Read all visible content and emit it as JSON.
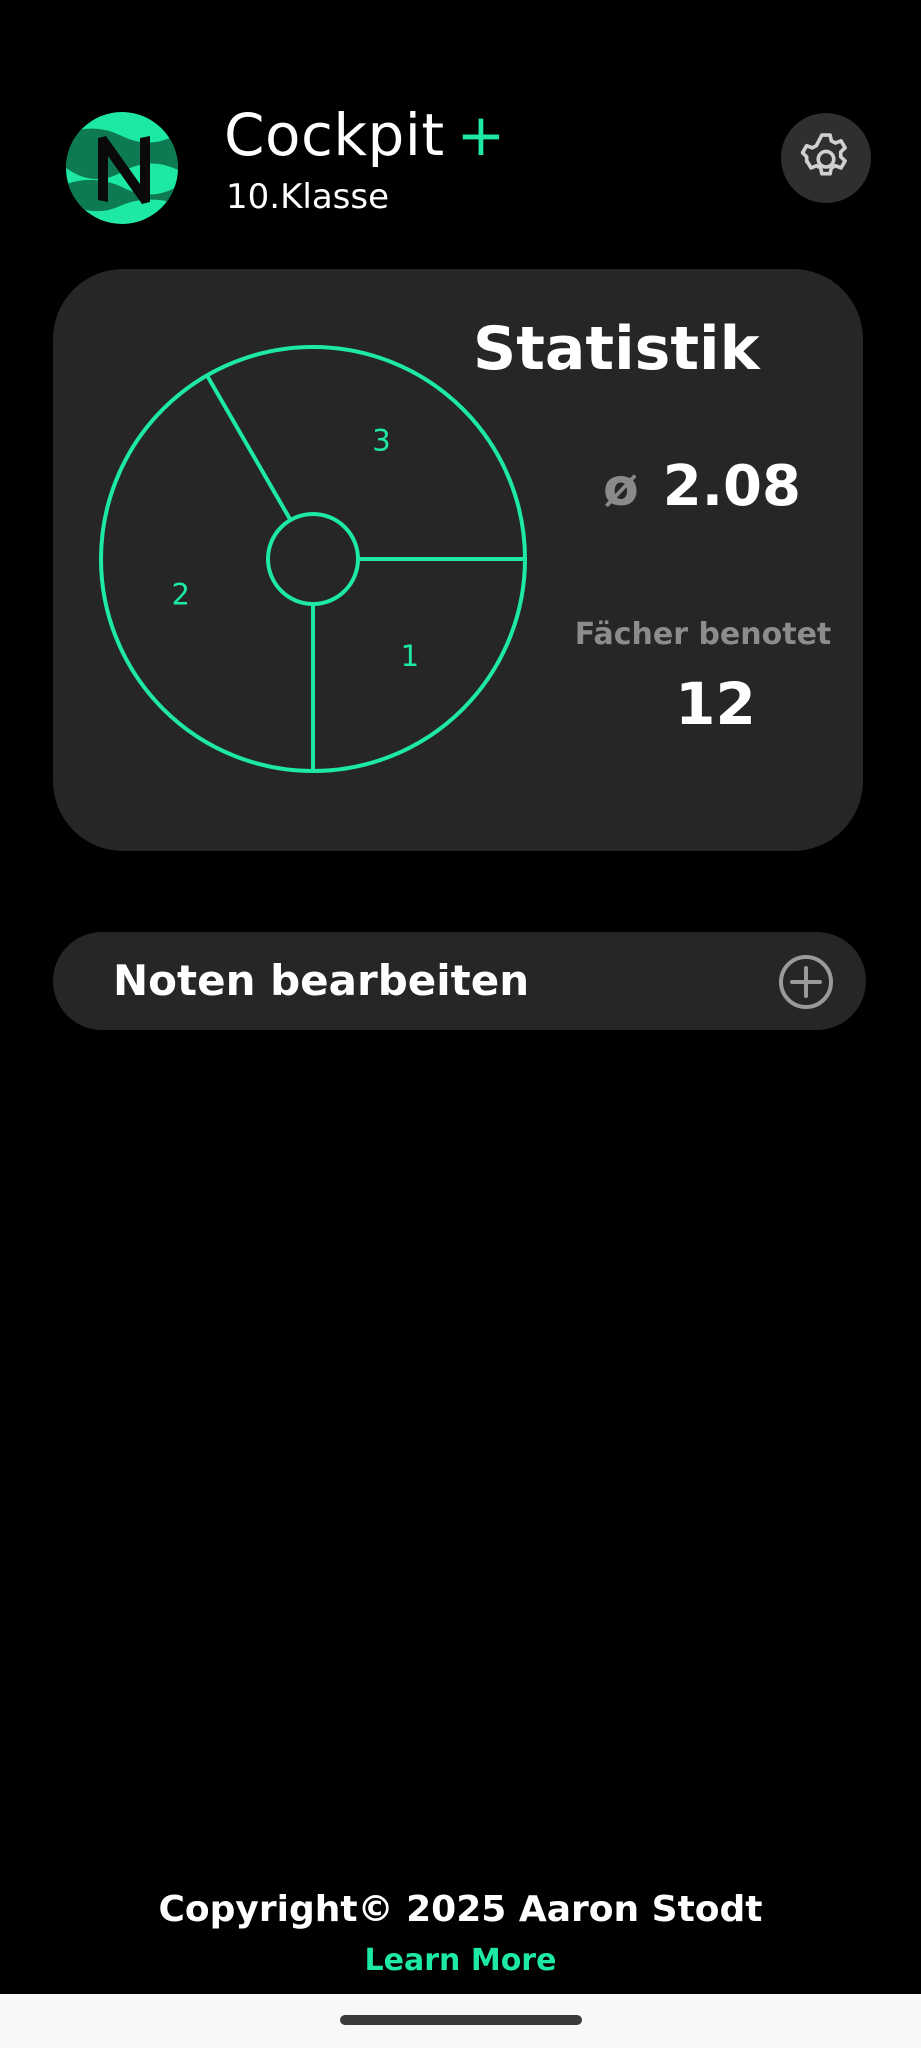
{
  "header": {
    "logo_icon": "app-logo-n",
    "title": "Cockpit",
    "title_accent": "+",
    "subtitle": "10.Klasse",
    "settings_icon": "gear-icon"
  },
  "stats": {
    "title": "Statistik",
    "avg_symbol": "ø",
    "avg_value": "2.08",
    "graded_label": "Fächer benotet",
    "graded_value": "12"
  },
  "chart_data": {
    "type": "pie",
    "title": "",
    "categories": [
      "1",
      "2",
      "3"
    ],
    "values": [
      3,
      5,
      4
    ],
    "labels": [
      "1",
      "2",
      "3"
    ],
    "style": "outline-donut",
    "stroke_color": "#1de9a4"
  },
  "edit": {
    "label": "Noten bearbeiten",
    "add_icon": "plus-circle-icon"
  },
  "footer": {
    "copyright": "Copyright© 2025 Aaron Stodt",
    "learn_more": "Learn More"
  },
  "colors": {
    "accent": "#1de9a4",
    "background": "#000000",
    "card": "#262626",
    "muted_text": "#8c8c8c"
  }
}
